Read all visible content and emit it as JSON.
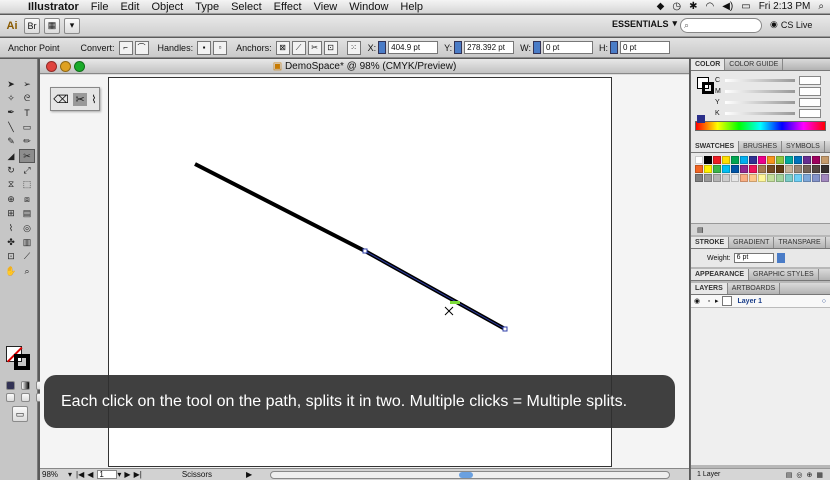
{
  "menubar": {
    "items": [
      "Illustrator",
      "File",
      "Edit",
      "Object",
      "Type",
      "Select",
      "Effect",
      "View",
      "Window",
      "Help"
    ],
    "clock": "Fri 2:13 PM"
  },
  "appbar": {
    "workspace": "ESSENTIALS",
    "cs_live": "CS Live"
  },
  "controlbar": {
    "mode": "Anchor Point",
    "convert_label": "Convert:",
    "handles_label": "Handles:",
    "anchors_label": "Anchors:",
    "x_label": "X:",
    "x_value": "404.9 pt",
    "y_label": "Y:",
    "y_value": "278.392 pt",
    "w_label": "W:",
    "w_value": "0 pt",
    "h_label": "H:",
    "h_value": "0 pt"
  },
  "document": {
    "title": "DemoSpace* @ 98% (CMYK/Preview)",
    "zoom": "98%",
    "page": "1",
    "status_tool": "Scissors"
  },
  "caption": "Each click on the tool on the path, splits it in two. Multiple clicks = Multiple splits.",
  "panels": {
    "color": {
      "tabs": [
        "COLOR",
        "COLOR GUIDE"
      ],
      "channels": [
        "C",
        "M",
        "Y",
        "K"
      ]
    },
    "swatches": {
      "tabs": [
        "SWATCHES",
        "BRUSHES",
        "SYMBOLS"
      ]
    },
    "stroke": {
      "tabs": [
        "STROKE",
        "GRADIENT",
        "TRANSPARE"
      ],
      "weight_label": "Weight:",
      "weight_value": "6 pt"
    },
    "appearance": {
      "tabs": [
        "APPEARANCE",
        "GRAPHIC STYLES"
      ]
    },
    "layers": {
      "tabs": [
        "LAYERS",
        "ARTBOARDS"
      ],
      "layer_name": "Layer 1",
      "footer": "1 Layer"
    }
  },
  "colors": {
    "accent": "#4a7cc7",
    "path_stroke": "#000000",
    "selection": "#2f3fa8"
  }
}
